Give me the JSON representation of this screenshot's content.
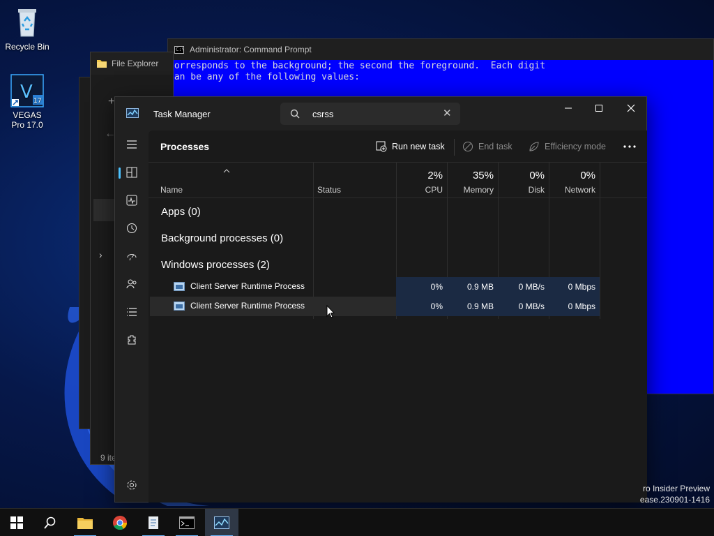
{
  "desktop": {
    "icons": [
      {
        "label": "Recycle Bin"
      },
      {
        "label": "VEGAS Pro 17.0"
      }
    ],
    "watermark_line1": "ro Insider Preview",
    "watermark_line2": "ease.230901-1416"
  },
  "cmd": {
    "title": "Administrator: Command Prompt",
    "lines": [
      "corresponds to the background; the second the foreground.  Each digit",
      "can be any of the following values:"
    ]
  },
  "explorer": {
    "title": "File Explorer",
    "status": "9 ite"
  },
  "task_manager": {
    "title": "Task Manager",
    "search": {
      "value": "csrss",
      "placeholder": ""
    },
    "page_title": "Processes",
    "commands": {
      "run_new_task": "Run new task",
      "end_task": "End task",
      "efficiency_mode": "Efficiency mode"
    },
    "columns": {
      "name": "Name",
      "status": "Status",
      "cpu": {
        "pct": "2%",
        "label": "CPU"
      },
      "memory": {
        "pct": "35%",
        "label": "Memory"
      },
      "disk": {
        "pct": "0%",
        "label": "Disk"
      },
      "network": {
        "pct": "0%",
        "label": "Network"
      }
    },
    "groups": {
      "apps": "Apps (0)",
      "background": "Background processes (0)",
      "windows": "Windows processes (2)"
    },
    "processes": [
      {
        "name": "Client Server Runtime Process",
        "cpu": "0%",
        "memory": "0.9 MB",
        "disk": "0 MB/s",
        "network": "0 Mbps"
      },
      {
        "name": "Client Server Runtime Process",
        "cpu": "0%",
        "memory": "0.9 MB",
        "disk": "0 MB/s",
        "network": "0 Mbps"
      }
    ]
  },
  "colors": {
    "accent": "#4cc2ff",
    "cmd_background": "#0000ff",
    "metric_highlight": "#1b2a43"
  }
}
